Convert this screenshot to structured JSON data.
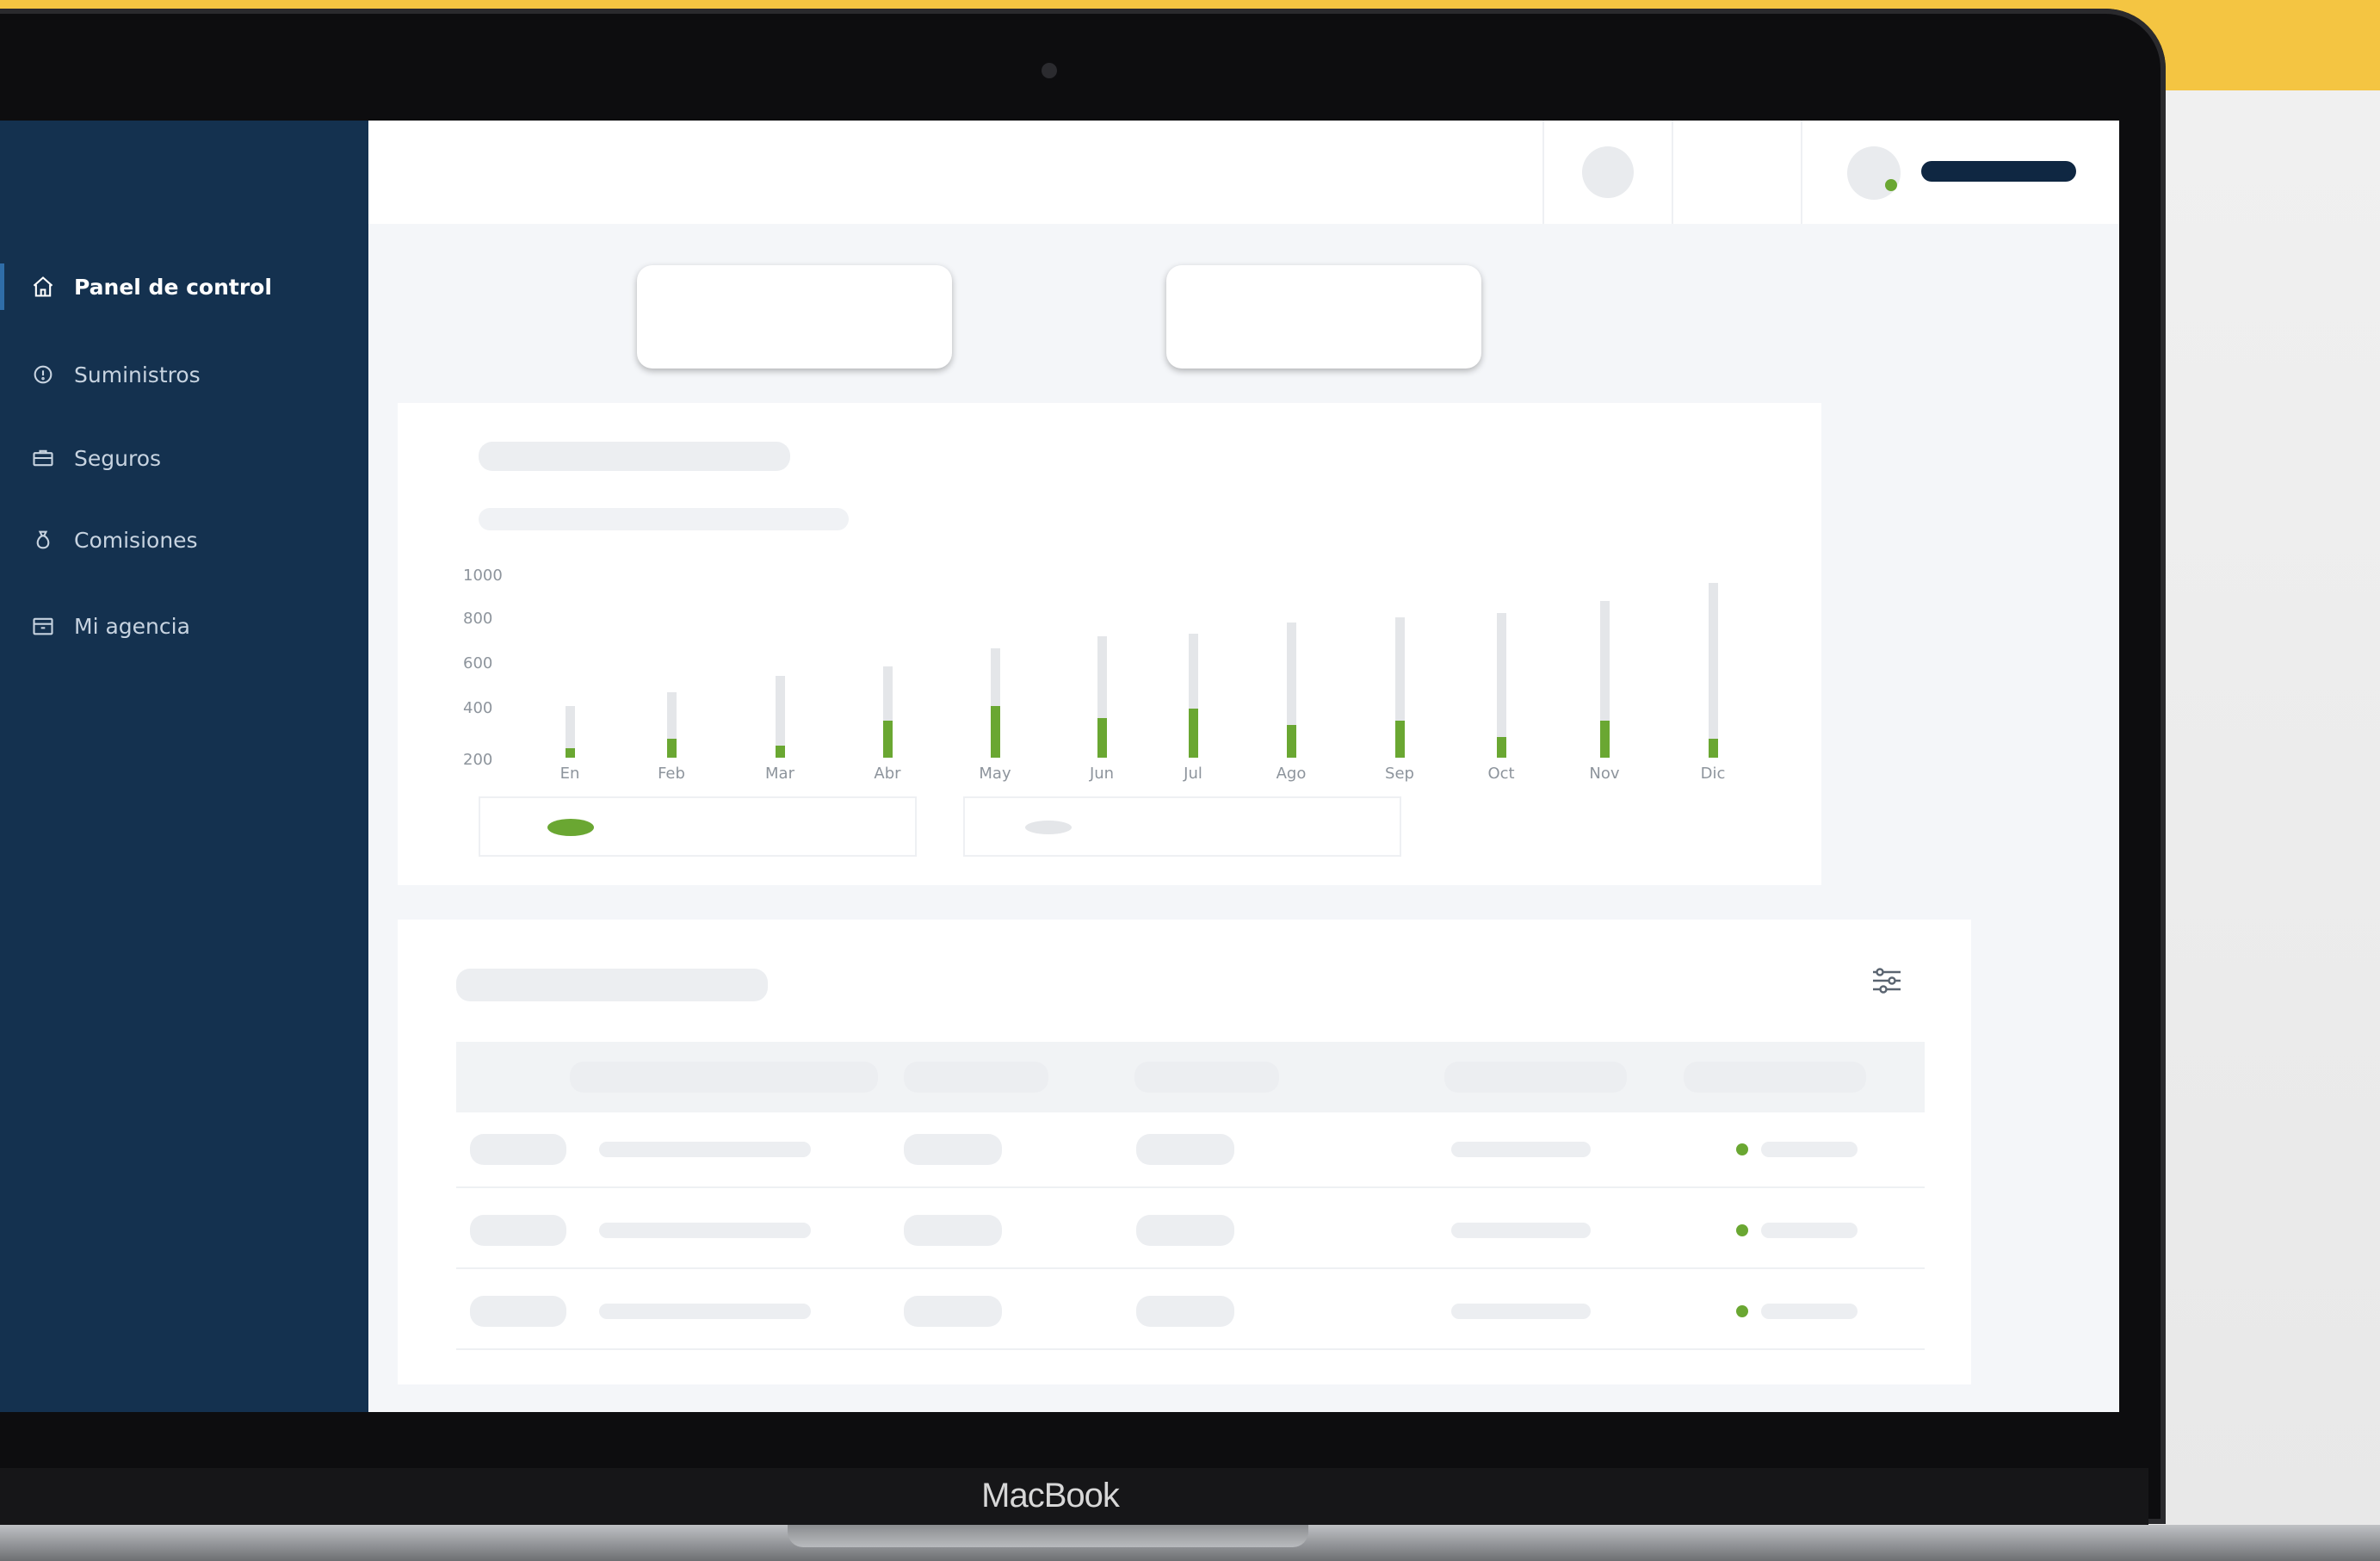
{
  "background": {
    "accent": "#f4c542"
  },
  "device": {
    "brand": "MacBook"
  },
  "sidebar": {
    "bg_color": "#14314f",
    "items": [
      {
        "label": "Panel de control",
        "icon": "home-icon",
        "active": true
      },
      {
        "label": "Suministros",
        "icon": "info-circle-icon",
        "active": false
      },
      {
        "label": "Seguros",
        "icon": "briefcase-icon",
        "active": false
      },
      {
        "label": "Comisiones",
        "icon": "money-bag-icon",
        "active": false
      },
      {
        "label": "Mi agencia",
        "icon": "calendar-icon",
        "active": false
      }
    ]
  },
  "header": {
    "user_status_color": "#6aa732"
  },
  "chart_data": {
    "type": "bar",
    "categories": [
      "En",
      "Feb",
      "Mar",
      "Abr",
      "May",
      "Jun",
      "Jul",
      "Ago",
      "Sep",
      "Oct",
      "Nov",
      "Dic"
    ],
    "y_ticks": [
      "1000",
      "800",
      "600",
      "400",
      "200"
    ],
    "ylim": [
      200,
      1000
    ],
    "series": [
      {
        "color": "#e4e6e9",
        "values": [
          420,
          480,
          550,
          590,
          670,
          720,
          730,
          780,
          800,
          820,
          870,
          950
        ]
      },
      {
        "color": "#6aa732",
        "values": [
          240,
          280,
          250,
          360,
          420,
          370,
          410,
          340,
          360,
          290,
          360,
          280
        ]
      }
    ],
    "legend_colors": [
      "#6aa732",
      "#e4e6e9"
    ],
    "grid": false
  },
  "table": {
    "status_color": "#6aa732",
    "rows": 3
  }
}
